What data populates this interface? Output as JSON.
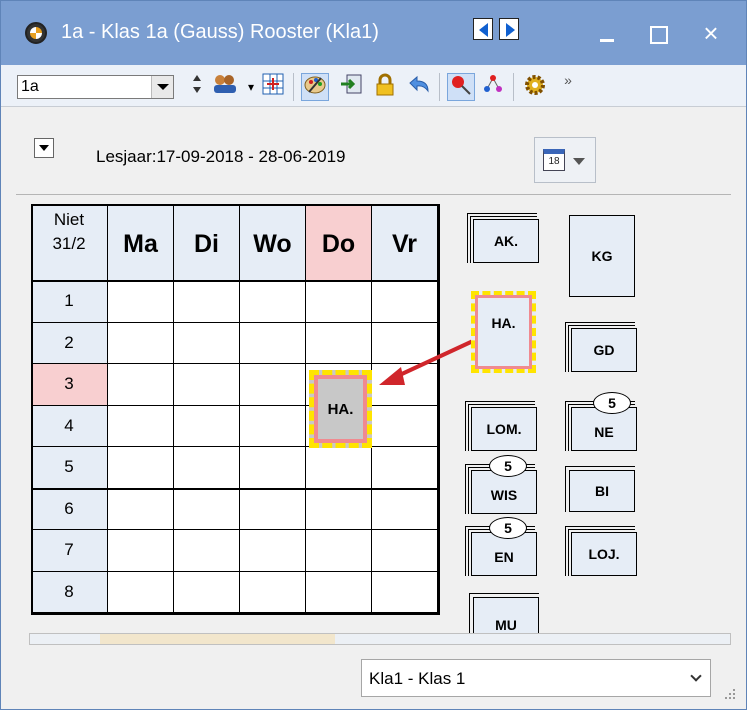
{
  "window": {
    "title": "1a - Klas 1a (Gauss)  Rooster  (Kla1)",
    "close_glyph": "×"
  },
  "toolbar": {
    "class_value": "1a",
    "overflow_glyph": "»"
  },
  "header": {
    "lesjaar": "Lesjaar:17-09-2018 - 28-06-2019",
    "calendar_day": "18"
  },
  "grid": {
    "corner_top": "Niet",
    "corner_bottom": "31/2",
    "days": [
      "Ma",
      "Di",
      "Wo",
      "Do",
      "Vr"
    ],
    "highlight_day": "Do",
    "periods": [
      "1",
      "2",
      "3",
      "4",
      "5",
      "6",
      "7",
      "8"
    ],
    "highlight_period": "3",
    "placed_lesson": "HA."
  },
  "pool": {
    "ak": "AK.",
    "kg": "KG",
    "ha": "HA.",
    "gd": "GD",
    "lom": "LOM.",
    "ne": "NE",
    "ne_badge": "5",
    "wis": "WIS",
    "wis_badge": "5",
    "bi": "BI",
    "en": "EN",
    "en_badge": "5",
    "loj": "LOJ.",
    "mu": "MU"
  },
  "status": {
    "class_select": "Kla1 - Klas 1"
  },
  "colors": {
    "titlebar": "#7b9ed1",
    "header_cell": "#e6edf6",
    "highlight": "#f8cfd0",
    "selected_border_yellow": "#ffe400",
    "selected_border_red": "#f08a90",
    "arrow": "#d0262b"
  }
}
